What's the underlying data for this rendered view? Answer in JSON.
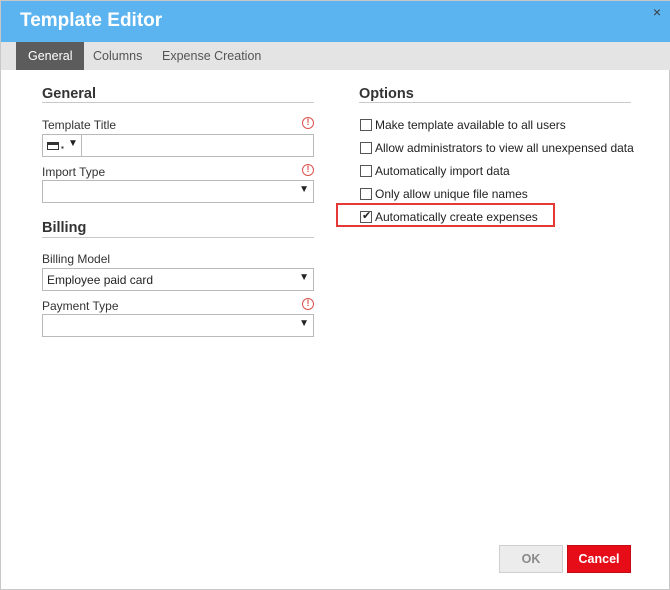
{
  "window": {
    "title": "Template Editor",
    "close_glyph": "×"
  },
  "tabs": [
    {
      "label": "General",
      "active": true
    },
    {
      "label": "Columns",
      "active": false
    },
    {
      "label": "Expense Creation",
      "active": false
    }
  ],
  "general": {
    "heading": "General",
    "template_title": {
      "label": "Template Title",
      "value": "",
      "required": true
    },
    "import_type": {
      "label": "Import Type",
      "value": "",
      "required": true
    }
  },
  "billing": {
    "heading": "Billing",
    "billing_model": {
      "label": "Billing Model",
      "value": "Employee paid card"
    },
    "payment_type": {
      "label": "Payment Type",
      "value": "",
      "required": true
    }
  },
  "options": {
    "heading": "Options",
    "items": [
      {
        "label": "Make template available to all users",
        "checked": false
      },
      {
        "label": "Allow administrators to view all unexpensed data",
        "checked": false
      },
      {
        "label": "Automatically import data",
        "checked": false
      },
      {
        "label": "Only allow unique file names",
        "checked": false
      },
      {
        "label": "Automatically create expenses",
        "checked": true,
        "highlighted": true
      }
    ]
  },
  "footer": {
    "ok_label": "OK",
    "cancel_label": "Cancel"
  },
  "icons": {
    "required": "exclamation-circle-icon",
    "dropdown": "chevron-down-icon",
    "checkmark": "checkmark-icon",
    "card": "credit-card-icon"
  },
  "colors": {
    "titlebar": "#5bb3ef",
    "active_tab": "#5c5c5c",
    "required": "#d9534f",
    "highlight": "#e53935",
    "cancel": "#e60c18"
  }
}
